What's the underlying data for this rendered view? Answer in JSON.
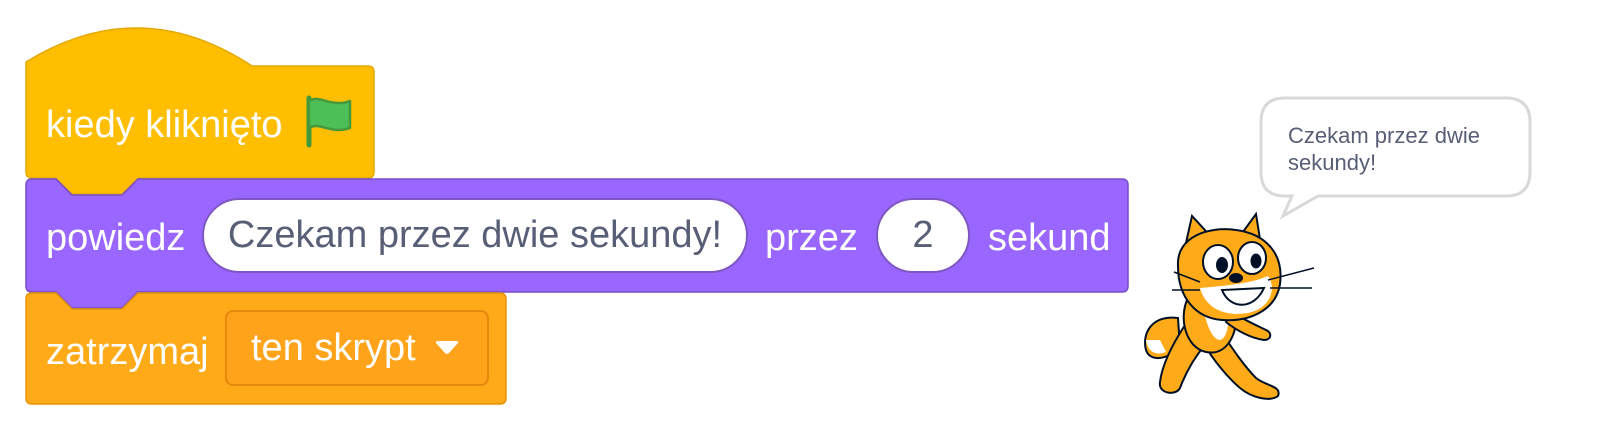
{
  "colors": {
    "events": "#ffbf00",
    "looks": "#9966ff",
    "control": "#ffab19",
    "flag": "#4cbf56",
    "input_text": "#575e75",
    "bubble_border": "#d8d8d8"
  },
  "blocks": {
    "hat": {
      "label": "kiedy kliknięto",
      "icon": "green-flag-icon"
    },
    "say": {
      "label_before": "powiedz",
      "message": "Czekam przez dwie sekundy!",
      "label_middle": "przez",
      "seconds": "2",
      "label_after": "sekund"
    },
    "stop": {
      "label": "zatrzymaj",
      "option": "ten skrypt",
      "dropdown_icon": "caret-down-icon"
    }
  },
  "stage": {
    "sprite": "scratch-cat",
    "speech_bubble": "Czekam przez dwie sekundy!"
  }
}
